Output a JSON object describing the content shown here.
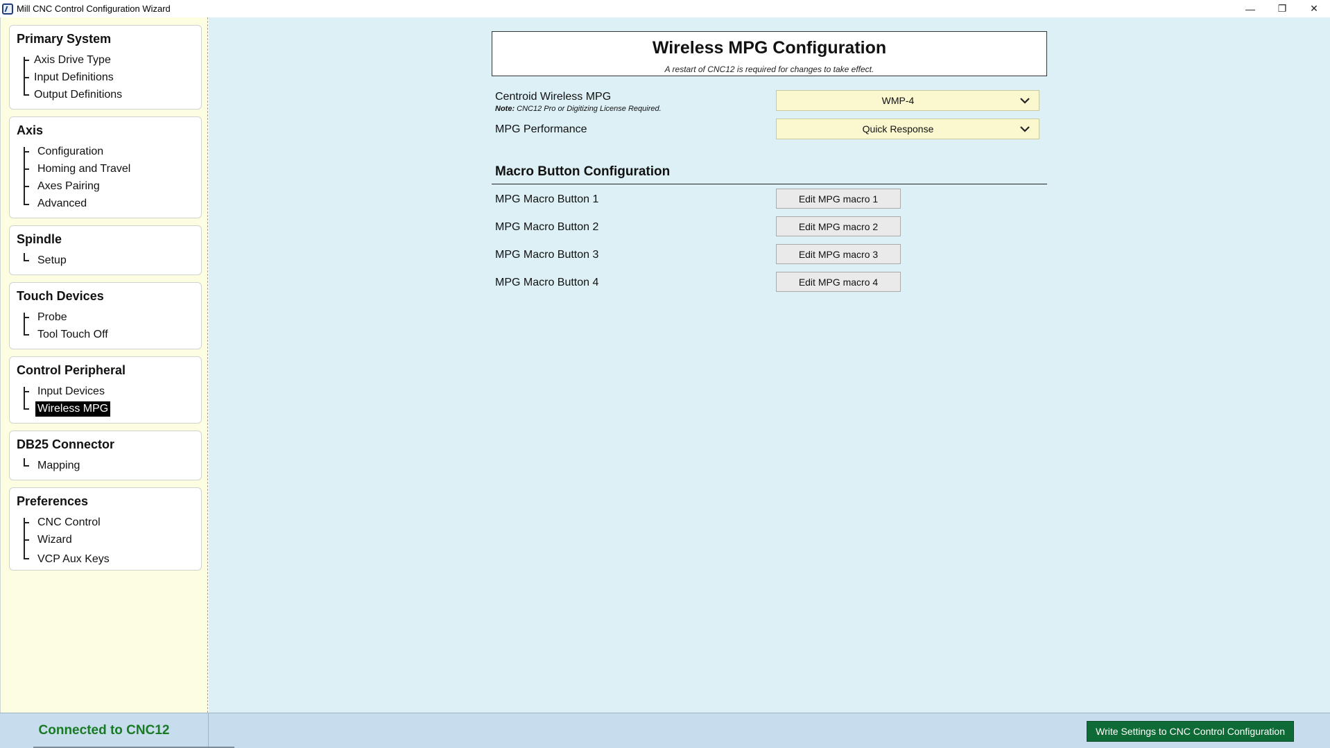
{
  "window": {
    "title": "Mill CNC Control Configuration Wizard",
    "minimize": "—",
    "restore": "❐",
    "close": "✕"
  },
  "sidebar": {
    "groups": [
      {
        "title": "Primary System",
        "items": [
          "Axis Drive Type",
          "Input Definitions",
          "Output Definitions"
        ]
      },
      {
        "title": "Axis",
        "items": [
          "Configuration",
          "Homing and Travel",
          "Axes Pairing",
          "Advanced"
        ]
      },
      {
        "title": "Spindle",
        "items": [
          "Setup"
        ]
      },
      {
        "title": "Touch Devices",
        "items": [
          "Probe",
          "Tool Touch Off"
        ]
      },
      {
        "title": "Control Peripheral",
        "items": [
          "Input Devices",
          "Wireless MPG"
        ]
      },
      {
        "title": "DB25 Connector",
        "items": [
          "Mapping"
        ]
      },
      {
        "title": "Preferences",
        "items": [
          "CNC Control",
          "Wizard",
          "VCP Aux Keys"
        ]
      }
    ],
    "selected_item": "Wireless MPG"
  },
  "main": {
    "header": {
      "title": "Wireless MPG Configuration",
      "subtitle": "A restart of CNC12 is required for changes to take effect."
    },
    "fields": {
      "wireless_mpg": {
        "label": "Centroid Wireless MPG",
        "note_bold": "Note:",
        "note_text": " CNC12 Pro or Digitizing License Required.",
        "value": "WMP-4"
      },
      "performance": {
        "label": "MPG Performance",
        "value": "Quick Response"
      }
    },
    "macro_section": {
      "title": "Macro Button Configuration",
      "rows": [
        {
          "label": "MPG Macro Button 1",
          "button": "Edit MPG macro 1"
        },
        {
          "label": "MPG Macro Button 2",
          "button": "Edit MPG macro 2"
        },
        {
          "label": "MPG Macro Button 3",
          "button": "Edit MPG macro 3"
        },
        {
          "label": "MPG Macro Button 4",
          "button": "Edit MPG macro 4"
        }
      ]
    }
  },
  "statusbar": {
    "connection": "Connected to CNC12",
    "write_button": "Write Settings to CNC Control Configuration"
  },
  "colors": {
    "sidebar_bg": "#fdfde1",
    "main_bg": "#dcf0f6",
    "dropdown_bg": "#fbf7cf",
    "status_bg": "#c7dced",
    "connected_green": "#187a25",
    "write_button_bg": "#0f6b36"
  }
}
